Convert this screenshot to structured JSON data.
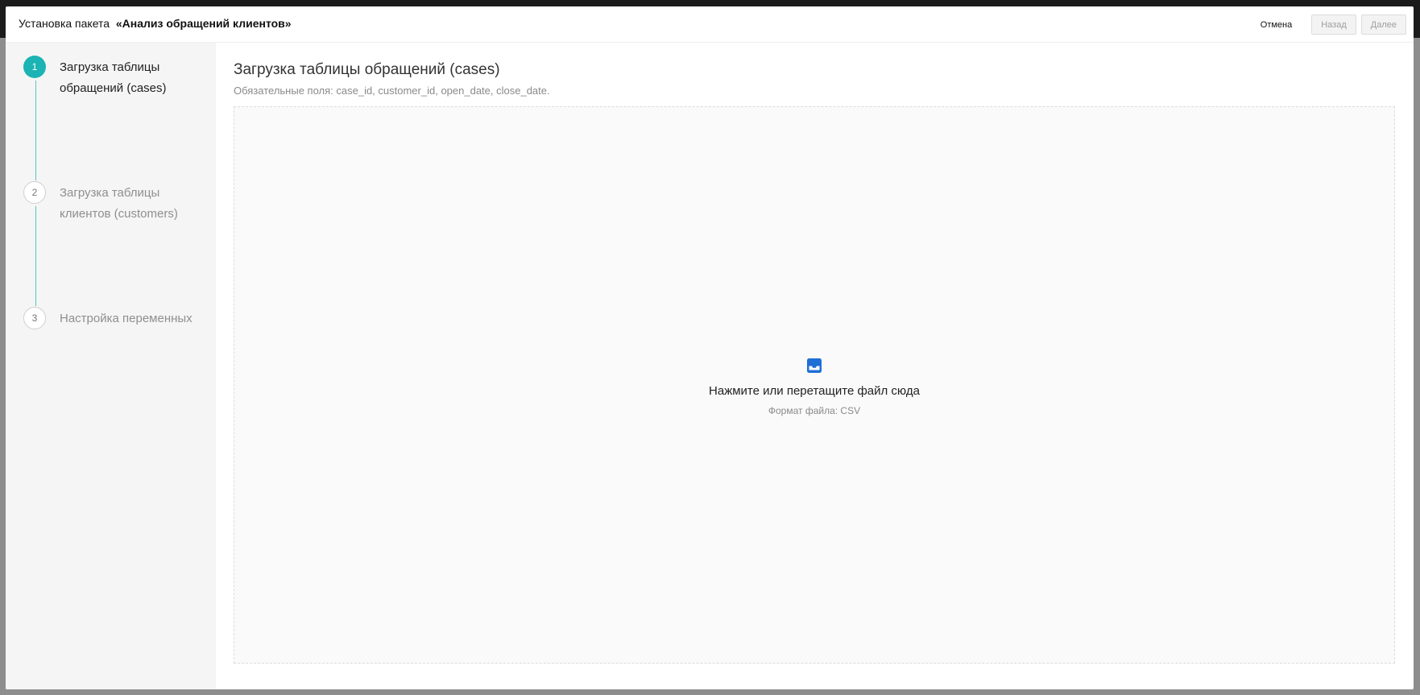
{
  "header": {
    "title_prefix": "Установка пакета  ",
    "package_name": "«Анализ обращений клиентов»",
    "cancel_label": "Отмена",
    "back_label": "Назад",
    "next_label": "Далее"
  },
  "steps": [
    {
      "number": "1",
      "label": "Загрузка таблицы обращений (cases)",
      "state": "active"
    },
    {
      "number": "2",
      "label": "Загрузка таблицы клиентов (customers)",
      "state": "inactive"
    },
    {
      "number": "3",
      "label": "Настройка переменных",
      "state": "inactive"
    }
  ],
  "main": {
    "title": "Загрузка таблицы обращений (cases)",
    "subtitle": "Обязательные поля: case_id, customer_id, open_date, close_date.",
    "dropzone": {
      "icon": "inbox-icon",
      "text": "Нажмите или перетащите файл сюда",
      "hint": "Формат файла: CSV"
    }
  },
  "colors": {
    "accent": "#1bb3b3",
    "icon": "#1f6fd6"
  }
}
